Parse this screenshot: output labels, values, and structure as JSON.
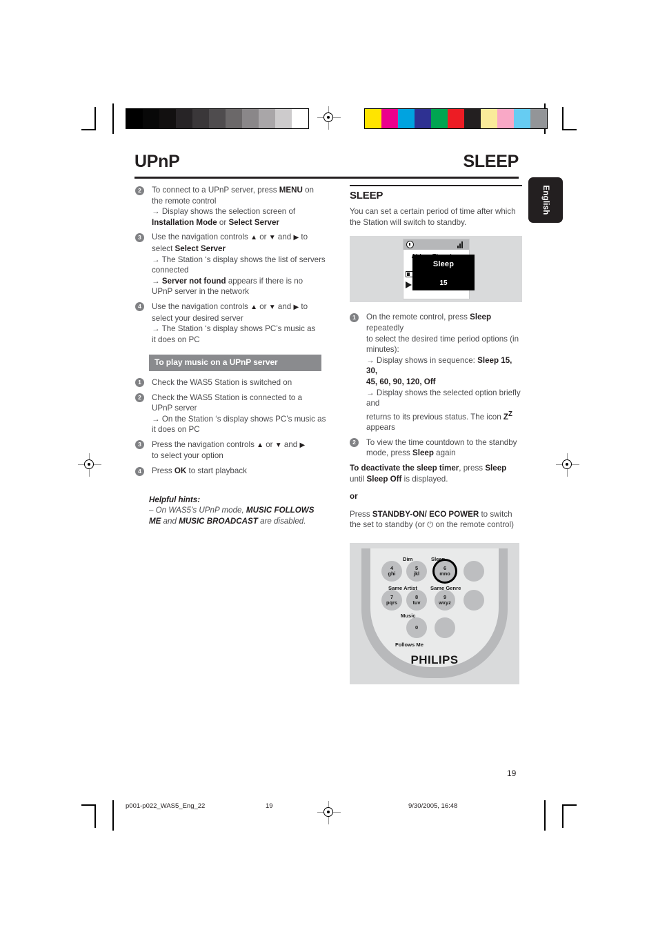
{
  "header": {
    "left_title": "UPnP",
    "right_title": "SLEEP"
  },
  "language_tab": {
    "label": "English"
  },
  "left_column": {
    "steps": [
      {
        "num": "2",
        "lines": [
          "To connect to a UPnP server, press <b>MENU</b> on",
          "the remote control",
          "<span class=\"arrow\">→</span> Display shows the selection screen of",
          "<b>Installation Mode</b> or <b>Select Server</b>"
        ]
      },
      {
        "num": "3",
        "lines": [
          "Use the navigation controls <span class=\"tri\">▲</span> or <span class=\"tri\">▼</span> and <span class=\"tri\">▶</span> to",
          "select <b>Select Server</b>",
          "<span class=\"arrow\">→</span> The Station ‘s display shows the list of servers",
          "connected",
          "<span class=\"arrow\">→</span> <b>Server not found</b> appears if there is no",
          "UPnP server in the network"
        ]
      },
      {
        "num": "4",
        "lines": [
          "Use the navigation controls <span class=\"tri\">▲</span> or <span class=\"tri\">▼</span> and <span class=\"tri\">▶</span> to",
          "select your desired server",
          "<span class=\"arrow\">→</span> The Station ‘s display shows PC’s music as",
          "it does on PC"
        ]
      }
    ],
    "band_label": "To play music on a UPnP server",
    "play_steps": [
      {
        "num": "1",
        "lines": [
          "Check the WAS5 Station is switched on"
        ]
      },
      {
        "num": "2",
        "lines": [
          "Check the WAS5 Station is connected to a",
          "UPnP server",
          "<span class=\"arrow\">→</span> On the Station ‘s display shows PC’s music as",
          "it does on PC"
        ]
      },
      {
        "num": "3",
        "lines": [
          "Press the navigation controls <span class=\"tri\">▲</span> or <span class=\"tri\">▼</span> and <span class=\"tri\">▶</span>",
          "to select your option"
        ]
      },
      {
        "num": "4",
        "lines": [
          "Press <b>OK</b> to start playback"
        ]
      }
    ],
    "hints": {
      "title": "Helpful hints:",
      "body": "– On WAS5’s UPnP mode, <b>MUSIC FOLLOWS ME</b> and <b>MUSIC BROADCAST</b> are disabled."
    }
  },
  "right_column": {
    "section_title": "SLEEP",
    "lead": "You can set a certain period of time after which the Station will switch to standby.",
    "lcd": {
      "track": "Abba - The win...",
      "overlay_title": "Sleep",
      "overlay_value": "15",
      "clock_icon": "clock-icon",
      "signal_icon": "signal-strength-icon",
      "play_icon": "play-icon"
    },
    "steps": [
      {
        "num": "1",
        "lines": [
          "On the remote control, press <b>Sleep</b> repeatedly",
          "to select the desired time period options (in",
          "minutes):",
          "<span class=\"arrow\">→</span> Display shows in sequence: <b>Sleep 15,&nbsp; 30,</b>",
          "<b>45, 60, 90, 120, Off</b>",
          "<span class=\"arrow\">→</span> Display shows the selected option briefly and",
          "returns to its previous status. The icon <b>Z<sup>Z</sup></b> appears"
        ]
      },
      {
        "num": "2",
        "lines": [
          "To view the time countdown to the standby",
          "mode, press <b>Sleep</b> again"
        ]
      }
    ],
    "notes": [
      "<b>To deactivate the sleep timer</b>, press <b>Sleep</b> until <b>Sleep Off</b> is displayed.",
      "<b>or</b>",
      "Press <b>STANDBY-ON/ ECO POWER</b> to switch the set to standby (or ⏻ on the remote control)"
    ],
    "remote": {
      "brand": "PHILIPS",
      "labels": {
        "dim": "Dim",
        "sleep": "Sleep",
        "same_artist": "Same Artist",
        "same_genre": "Same Genre",
        "music": "Music",
        "follows_me": "Follows Me"
      },
      "keys": [
        {
          "digit": "4",
          "letters": "ghi",
          "highlighted": false
        },
        {
          "digit": "5",
          "letters": "jkl",
          "highlighted": false
        },
        {
          "digit": "6",
          "letters": "mno",
          "highlighted": true
        },
        {
          "digit": "7",
          "letters": "pqrs",
          "highlighted": false
        },
        {
          "digit": "8",
          "letters": "tuv",
          "highlighted": false
        },
        {
          "digit": "9",
          "letters": "wxyz",
          "highlighted": false
        },
        {
          "digit": "0",
          "letters": "",
          "highlighted": false
        }
      ]
    }
  },
  "footer": {
    "page_number": "19",
    "file_name": "p001-p022_WAS5_Eng_22",
    "center_number": "19",
    "timestamp": "9/30/2005, 16:48"
  },
  "print_marks": {
    "grayscale_bars": [
      "#000000",
      "#080808",
      "#121010",
      "#272426",
      "#3a3739",
      "#4f4c4e",
      "#6b6869",
      "#8a8789",
      "#a9a6a8",
      "#cdcbcc",
      "#ffffff"
    ],
    "color_bars": [
      "#ffe400",
      "#ec008c",
      "#00a3e0",
      "#2e3192",
      "#00a551",
      "#ed1c24",
      "#231f20",
      "#faeb9a",
      "#f9a8c6",
      "#66ccf2",
      "#939598"
    ]
  }
}
